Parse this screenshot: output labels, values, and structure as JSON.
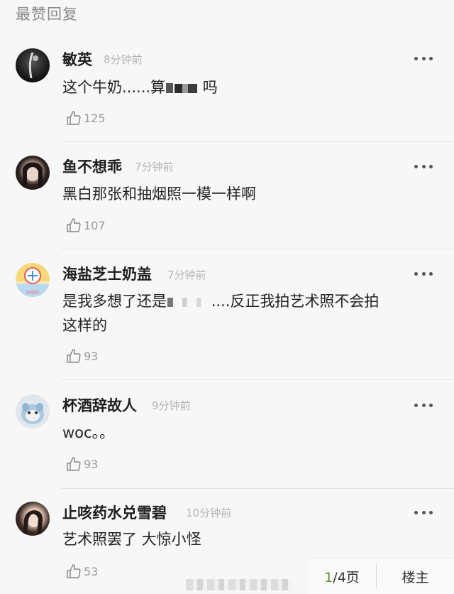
{
  "section_title": "最赞回复",
  "comments": [
    {
      "name": "敏英",
      "time": "8分钟前",
      "text_parts": [
        "这个牛奶......算",
        "吗"
      ],
      "likes": "125"
    },
    {
      "name": "鱼不想乖",
      "time": "7分钟前",
      "text": "黑白那张和抽烟照一模一样啊",
      "likes": "107"
    },
    {
      "name": "海盐芝士奶盖",
      "time": "7分钟前",
      "text_parts": [
        "是我多想了还是",
        "....反正我拍艺术照不会拍"
      ],
      "text_line2": "这样的",
      "likes": "93"
    },
    {
      "name": "杯酒辞故人",
      "time": "9分钟前",
      "text": "woc。。",
      "likes": "93"
    },
    {
      "name": "止咳药水兑雪碧",
      "time": "10分钟前",
      "text": "艺术照罢了 大惊小怪",
      "likes": "53"
    }
  ],
  "pager": {
    "current": "1",
    "total": "/4页",
    "floor_label": "楼主"
  },
  "icons": {
    "more": "more-dots-icon",
    "like": "thumb-up-icon"
  },
  "colors": {
    "background": "#f7f7f7",
    "name": "#1d1d1d",
    "meta": "#b3b3b3",
    "accent": "#5b8a2d"
  }
}
